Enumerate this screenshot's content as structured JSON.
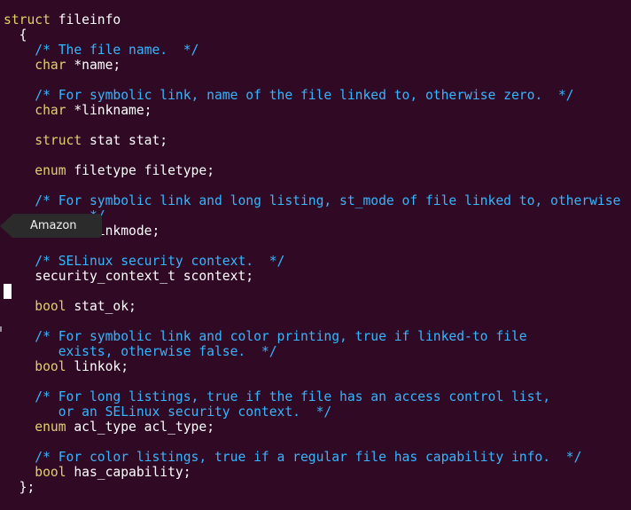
{
  "colors": {
    "background": "#300a24",
    "keyword": "#e2d06f",
    "comment": "#35b6ff",
    "text": "#ffffff",
    "tooltip_bg": "#2b2b2b"
  },
  "tooltip": {
    "label": "Amazon",
    "icon": "amazon-launcher-icon"
  },
  "code": {
    "lines": [
      [
        {
          "t": "kw",
          "v": "struct"
        },
        {
          "t": "tx",
          "v": " fileinfo"
        }
      ],
      [
        {
          "t": "tx",
          "v": "  {"
        }
      ],
      [
        {
          "t": "tx",
          "v": "    "
        },
        {
          "t": "cm",
          "v": "/* The file name.  */"
        }
      ],
      [
        {
          "t": "tx",
          "v": "    "
        },
        {
          "t": "kw",
          "v": "char"
        },
        {
          "t": "tx",
          "v": " *name;"
        }
      ],
      [],
      [
        {
          "t": "tx",
          "v": "    "
        },
        {
          "t": "cm",
          "v": "/* For symbolic link, name of the file linked to, otherwise zero.  */"
        }
      ],
      [
        {
          "t": "tx",
          "v": "    "
        },
        {
          "t": "kw",
          "v": "char"
        },
        {
          "t": "tx",
          "v": " *linkname;"
        }
      ],
      [],
      [
        {
          "t": "tx",
          "v": "    "
        },
        {
          "t": "kw",
          "v": "struct"
        },
        {
          "t": "tx",
          "v": " stat stat;"
        }
      ],
      [],
      [
        {
          "t": "tx",
          "v": "    "
        },
        {
          "t": "kw",
          "v": "enum"
        },
        {
          "t": "tx",
          "v": " filetype filetype;"
        }
      ],
      [],
      [
        {
          "t": "tx",
          "v": "    "
        },
        {
          "t": "cm",
          "v": "/* For symbolic link and long listing, st_mode of file linked to, otherwise"
        }
      ],
      [
        {
          "t": "tx",
          "v": "       "
        },
        {
          "t": "cm",
          "v": "    */"
        }
      ],
      [
        {
          "t": "tx",
          "v": "            inkmode;"
        }
      ],
      [],
      [
        {
          "t": "tx",
          "v": "    "
        },
        {
          "t": "cm",
          "v": "/* SELinux security context.  */"
        }
      ],
      [
        {
          "t": "tx",
          "v": "    security_context_t scontext;"
        }
      ],
      [],
      [
        {
          "t": "tx",
          "v": "    "
        },
        {
          "t": "kw",
          "v": "bool"
        },
        {
          "t": "tx",
          "v": " stat_ok;"
        }
      ],
      [],
      [
        {
          "t": "tx",
          "v": "    "
        },
        {
          "t": "cm",
          "v": "/* For symbolic link and color printing, true if linked-to file"
        }
      ],
      [
        {
          "t": "tx",
          "v": "       "
        },
        {
          "t": "cm",
          "v": "exists, otherwise false.  */"
        }
      ],
      [
        {
          "t": "tx",
          "v": "    "
        },
        {
          "t": "kw",
          "v": "bool"
        },
        {
          "t": "tx",
          "v": " linkok;"
        }
      ],
      [],
      [
        {
          "t": "tx",
          "v": "    "
        },
        {
          "t": "cm",
          "v": "/* For long listings, true if the file has an access control list,"
        }
      ],
      [
        {
          "t": "tx",
          "v": "       "
        },
        {
          "t": "cm",
          "v": "or an SELinux security context.  */"
        }
      ],
      [
        {
          "t": "tx",
          "v": "    "
        },
        {
          "t": "kw",
          "v": "enum"
        },
        {
          "t": "tx",
          "v": " acl_type acl_type;"
        }
      ],
      [],
      [
        {
          "t": "tx",
          "v": "    "
        },
        {
          "t": "cm",
          "v": "/* For color listings, true if a regular file has capability info.  */"
        }
      ],
      [
        {
          "t": "tx",
          "v": "    "
        },
        {
          "t": "kw",
          "v": "bool"
        },
        {
          "t": "tx",
          "v": " has_capability;"
        }
      ],
      [
        {
          "t": "tx",
          "v": "  };"
        }
      ]
    ]
  }
}
